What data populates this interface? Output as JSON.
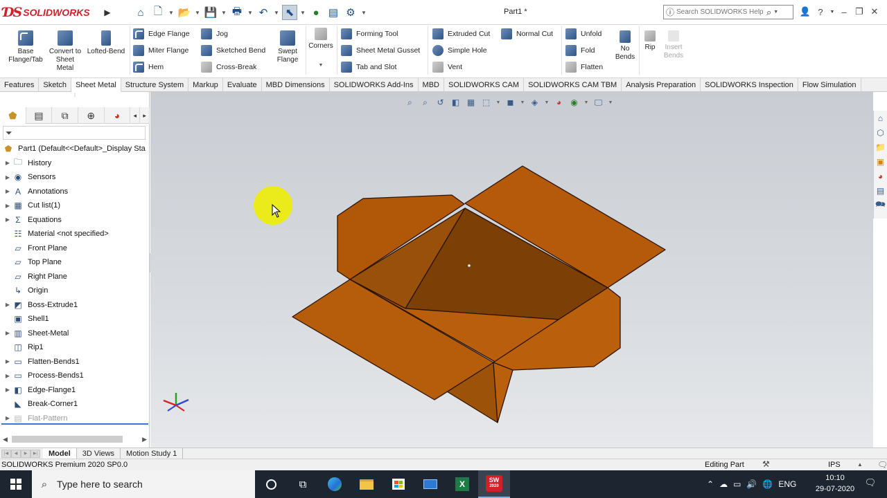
{
  "app": {
    "brand": "SOLIDWORKS",
    "doc_title": "Part1 *",
    "accent": "#d0202a"
  },
  "titlebar": {
    "search_placeholder": "Search SOLIDWORKS Help"
  },
  "ribbon": {
    "base_flange": "Base Flange/Tab",
    "convert": "Convert to Sheet Metal",
    "lofted_bend": "Lofted-Bend",
    "edge_flange": "Edge Flange",
    "miter_flange": "Miter Flange",
    "hem": "Hem",
    "jog": "Jog",
    "sketched_bend": "Sketched Bend",
    "cross_break": "Cross-Break",
    "swept_flange": "Swept Flange",
    "corners": "Corners",
    "forming_tool": "Forming Tool",
    "sheet_metal_gusset": "Sheet Metal Gusset",
    "tab_and_slot": "Tab and Slot",
    "extruded_cut": "Extruded Cut",
    "simple_hole": "Simple Hole",
    "vent": "Vent",
    "normal_cut": "Normal Cut",
    "unfold": "Unfold",
    "fold": "Fold",
    "flatten": "Flatten",
    "no_bends": "No Bends",
    "rip": "Rip",
    "insert_bends": "Insert Bends"
  },
  "command_tabs": [
    "Features",
    "Sketch",
    "Sheet Metal",
    "Structure System",
    "Markup",
    "Evaluate",
    "MBD Dimensions",
    "SOLIDWORKS Add-Ins",
    "MBD",
    "SOLIDWORKS CAM",
    "SOLIDWORKS CAM TBM",
    "Analysis Preparation",
    "SOLIDWORKS Inspection",
    "Flow Simulation"
  ],
  "active_command_tab": "Sheet Metal",
  "tree": {
    "root": "Part1  (Default<<Default>_Display Sta",
    "items": [
      {
        "label": "History",
        "icon": "history-folder-icon"
      },
      {
        "label": "Sensors",
        "icon": "sensor-icon"
      },
      {
        "label": "Annotations",
        "icon": "annotation-icon"
      },
      {
        "label": "Cut list(1)",
        "icon": "cut-list-icon"
      },
      {
        "label": "Equations",
        "icon": "equation-icon"
      },
      {
        "label": "Material <not specified>",
        "icon": "material-icon"
      },
      {
        "label": "Front Plane",
        "icon": "plane-icon"
      },
      {
        "label": "Top Plane",
        "icon": "plane-icon"
      },
      {
        "label": "Right Plane",
        "icon": "plane-icon"
      },
      {
        "label": "Origin",
        "icon": "origin-icon"
      },
      {
        "label": "Boss-Extrude1",
        "icon": "extrude-icon"
      },
      {
        "label": "Shell1",
        "icon": "shell-icon"
      },
      {
        "label": "Sheet-Metal",
        "icon": "sheet-metal-icon"
      },
      {
        "label": "Rip1",
        "icon": "rip-icon"
      },
      {
        "label": "Flatten-Bends1",
        "icon": "flatten-bends-icon"
      },
      {
        "label": "Process-Bends1",
        "icon": "process-bends-icon"
      },
      {
        "label": "Edge-Flange1",
        "icon": "edge-flange-icon"
      },
      {
        "label": "Break-Corner1",
        "icon": "break-corner-icon"
      },
      {
        "label": "Flat-Pattern",
        "icon": "flat-pattern-icon"
      }
    ]
  },
  "bottom_tabs": [
    "Model",
    "3D Views",
    "Motion Study 1"
  ],
  "status": {
    "left": "SOLIDWORKS Premium 2020 SP0.0",
    "mode": "Editing Part",
    "units": "IPS"
  },
  "taskbar": {
    "search_placeholder": "Type here to search",
    "language": "ENG",
    "time": "10:10",
    "date": "29-07-2020",
    "sw_badge": "2020"
  }
}
